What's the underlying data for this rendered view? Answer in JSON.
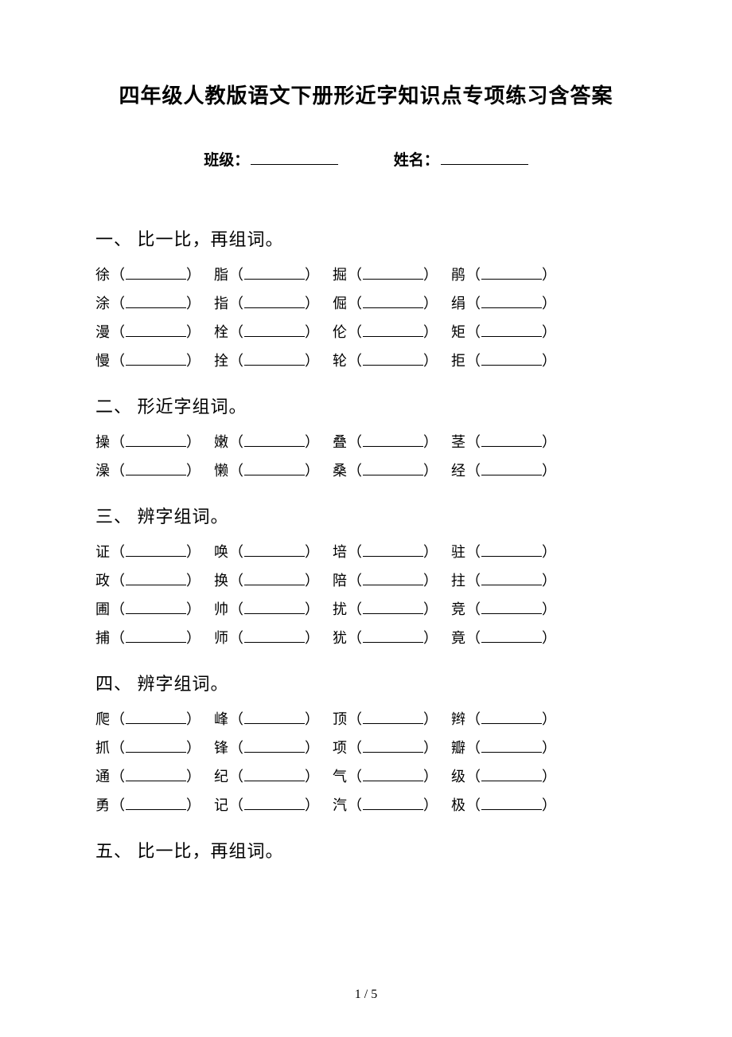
{
  "title": "四年级人教版语文下册形近字知识点专项练习含答案",
  "info": {
    "class_label": "班级：",
    "name_label": "姓名："
  },
  "sections": [
    {
      "num": "一、",
      "title": "比一比，再组词。",
      "rows": [
        [
          "徐",
          "脂",
          "掘",
          "鹃"
        ],
        [
          "涂",
          "指",
          "倔",
          "绢"
        ],
        [
          "漫",
          "栓",
          "伦",
          "矩"
        ],
        [
          "慢",
          "拴",
          "轮",
          "拒"
        ]
      ]
    },
    {
      "num": "二、",
      "title": "形近字组词。",
      "rows": [
        [
          "操",
          "嫩",
          "叠",
          "茎"
        ],
        [
          "澡",
          "懒",
          "桑",
          "经"
        ]
      ]
    },
    {
      "num": "三、",
      "title": "辨字组词。",
      "rows": [
        [
          "证",
          "唤",
          "培",
          "驻"
        ],
        [
          "政",
          "换",
          "陪",
          "拄"
        ],
        [
          "圃",
          "帅",
          "扰",
          "竞"
        ],
        [
          "捕",
          "师",
          "犹",
          "竟"
        ]
      ]
    },
    {
      "num": "四、",
      "title": "辨字组词。",
      "rows": [
        [
          "爬",
          "峰",
          "顶",
          "辫"
        ],
        [
          "抓",
          "锋",
          "项",
          "瓣"
        ],
        [
          "通",
          "纪",
          "气",
          "级"
        ],
        [
          "勇",
          "记",
          "汽",
          "极"
        ]
      ]
    },
    {
      "num": "五、",
      "title": "比一比，再组词。",
      "rows": []
    }
  ],
  "pagenum": "1 / 5"
}
